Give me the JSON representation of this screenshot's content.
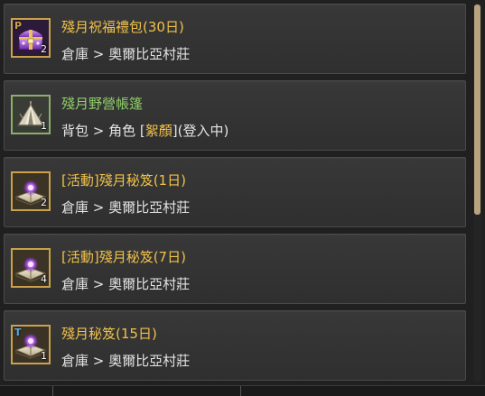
{
  "colors": {
    "name_yellow": "#f0c14a",
    "name_green": "#8fce6a",
    "location": "#e4e4e4",
    "highlight": "#f0c14a",
    "border_gold": "#c9a24a"
  },
  "items": [
    {
      "name": "殘月祝福禮包(30日)",
      "name_color": "yellow",
      "location": "倉庫 > 奧爾比亞村莊",
      "count": "2",
      "badge": "P",
      "icon": "purple-chest-icon"
    },
    {
      "name": "殘月野營帳篷",
      "name_color": "green",
      "location_prefix": "背包 > 角色 [",
      "location_highlight": "絮顏",
      "location_suffix": "](登入中)",
      "count": "1",
      "icon": "camping-tent-icon"
    },
    {
      "name": "[活動]殘月秘笈(1日)",
      "name_color": "yellow",
      "location": "倉庫 > 奧爾比亞村莊",
      "count": "2",
      "icon": "secret-book-icon"
    },
    {
      "name": "[活動]殘月秘笈(7日)",
      "name_color": "yellow",
      "location": "倉庫 > 奧爾比亞村莊",
      "count": "4",
      "icon": "secret-book-icon"
    },
    {
      "name": "殘月秘笈(15日)",
      "name_color": "yellow",
      "location": "倉庫 > 奧爾比亞村莊",
      "count": "1",
      "badge": "T",
      "icon": "secret-book-icon"
    }
  ],
  "scrollbar": {
    "position_fraction": 0.0,
    "visible_fraction": 0.56
  }
}
